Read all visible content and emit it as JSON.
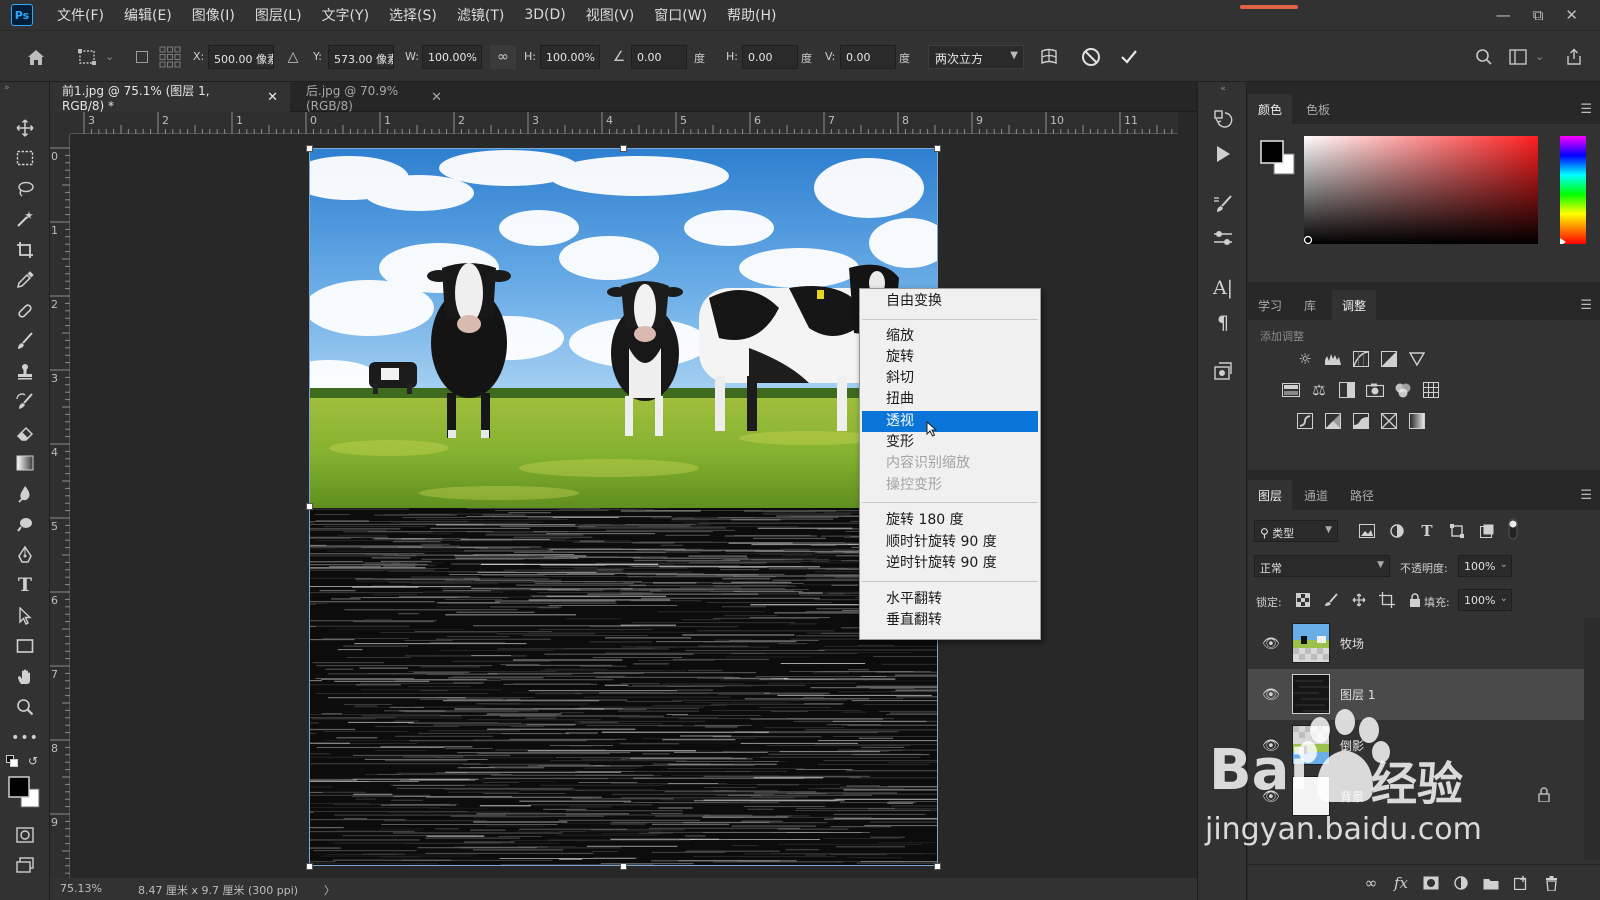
{
  "app": {
    "logo": "Ps",
    "menu": [
      "文件(F)",
      "编辑(E)",
      "图像(I)",
      "图层(L)",
      "文字(Y)",
      "选择(S)",
      "滤镜(T)",
      "3D(D)",
      "视图(V)",
      "窗口(W)",
      "帮助(H)"
    ],
    "window_controls": [
      "minimize-icon",
      "restore-icon",
      "close-icon"
    ]
  },
  "options": {
    "x_label": "X:",
    "x_value": "500.00 像素",
    "y_label": "Y:",
    "y_value": "573.00 像素",
    "w_label": "W:",
    "w_value": "100.00%",
    "h_label": "H:",
    "h_value": "100.00%",
    "angle_value": "0.00",
    "angle_unit": "度",
    "hskew_label": "H:",
    "hskew_value": "0.00",
    "hskew_unit": "度",
    "vskew_label": "V:",
    "vskew_value": "0.00",
    "vskew_unit": "度",
    "interpolation": "两次立方"
  },
  "tabs": [
    {
      "label": "前1.jpg @ 75.1% (图层 1, RGB/8) *",
      "active": true
    },
    {
      "label": "后.jpg @ 70.9%(RGB/8)",
      "active": false
    }
  ],
  "ruler": {
    "top": [
      "3",
      "2",
      "1",
      "0",
      "1",
      "2",
      "3",
      "4",
      "5",
      "6",
      "7",
      "8",
      "9",
      "10",
      "11"
    ],
    "left": [
      "0",
      "1",
      "2",
      "3",
      "4",
      "5",
      "6",
      "7",
      "8",
      "9"
    ]
  },
  "status": {
    "zoom": "75.13%",
    "doc_info": "8.47 厘米 x 9.7 厘米 (300 ppi)",
    "arrow": "〉"
  },
  "context_menu": {
    "items": [
      {
        "label": "自由变换",
        "state": "normal"
      },
      {
        "label": "缩放",
        "state": "normal"
      },
      {
        "label": "旋转",
        "state": "normal"
      },
      {
        "label": "斜切",
        "state": "normal"
      },
      {
        "label": "扭曲",
        "state": "normal"
      },
      {
        "label": "透视",
        "state": "selected"
      },
      {
        "label": "变形",
        "state": "normal"
      },
      {
        "label": "内容识别缩放",
        "state": "disabled"
      },
      {
        "label": "操控变形",
        "state": "disabled"
      },
      {
        "label": "旋转 180 度",
        "state": "normal"
      },
      {
        "label": "顺时针旋转 90 度",
        "state": "normal"
      },
      {
        "label": "逆时针旋转 90 度",
        "state": "normal"
      },
      {
        "label": "水平翻转",
        "state": "normal"
      },
      {
        "label": "垂直翻转",
        "state": "normal"
      }
    ]
  },
  "panels": {
    "color": {
      "tabs": [
        "颜色",
        "色板"
      ],
      "active": "颜色",
      "hue_color": "#ff1f1f"
    },
    "adjust": {
      "tabs": [
        "学习",
        "库",
        "调整"
      ],
      "active": "调整",
      "hint": "添加调整"
    },
    "layers": {
      "tabs": [
        "图层",
        "通道",
        "路径"
      ],
      "active": "图层",
      "filter_label": "类型",
      "blend_mode": "正常",
      "opacity_label": "不透明度:",
      "opacity_value": "100%",
      "lock_label": "锁定:",
      "fill_label": "填充:",
      "fill_value": "100%",
      "layers": [
        {
          "name": "牧场",
          "visible": true,
          "selected": false
        },
        {
          "name": "图层 1",
          "visible": true,
          "selected": true
        },
        {
          "name": "倒影",
          "visible": true,
          "selected": false
        },
        {
          "name": "背景",
          "visible": true,
          "selected": false,
          "locked": true
        }
      ],
      "footer_icons": [
        "link-icon",
        "fx-icon",
        "mask-icon",
        "adjustment-icon",
        "folder-icon",
        "new-layer-icon",
        "trash-icon"
      ]
    }
  },
  "watermark": {
    "brand": "Bai",
    "brand2": "经验",
    "url": "jingyan.baidu.com"
  }
}
